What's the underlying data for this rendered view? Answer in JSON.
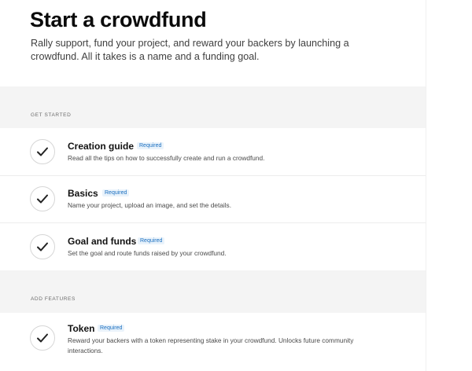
{
  "header": {
    "title": "Start a crowdfund",
    "subtitle": "Rally support, fund your project, and reward your backers by launching a crowdfund. All it takes is a name and a funding goal."
  },
  "sections": [
    {
      "label": "GET STARTED",
      "tasks": [
        {
          "name": "Creation guide",
          "badge": "Required",
          "description": "Read all the tips on how to successfully create and run a crowdfund."
        },
        {
          "name": "Basics",
          "badge": "Required",
          "description": "Name your project, upload an image, and set the details."
        },
        {
          "name": "Goal and funds",
          "badge": "Required",
          "description": "Set the goal and route funds raised by your crowdfund."
        }
      ]
    },
    {
      "label": "ADD FEATURES",
      "tasks": [
        {
          "name": "Token",
          "badge": "Required",
          "description": "Reward your backers with a token representing stake in your crowdfund. Unlocks future community interactions."
        }
      ]
    }
  ],
  "icons": {
    "task_status": "check-circle-icon"
  },
  "colors": {
    "badge_text": "#1a6fc0",
    "badge_bg": "#eaf3fb",
    "section_bg": "#f4f4f4"
  }
}
